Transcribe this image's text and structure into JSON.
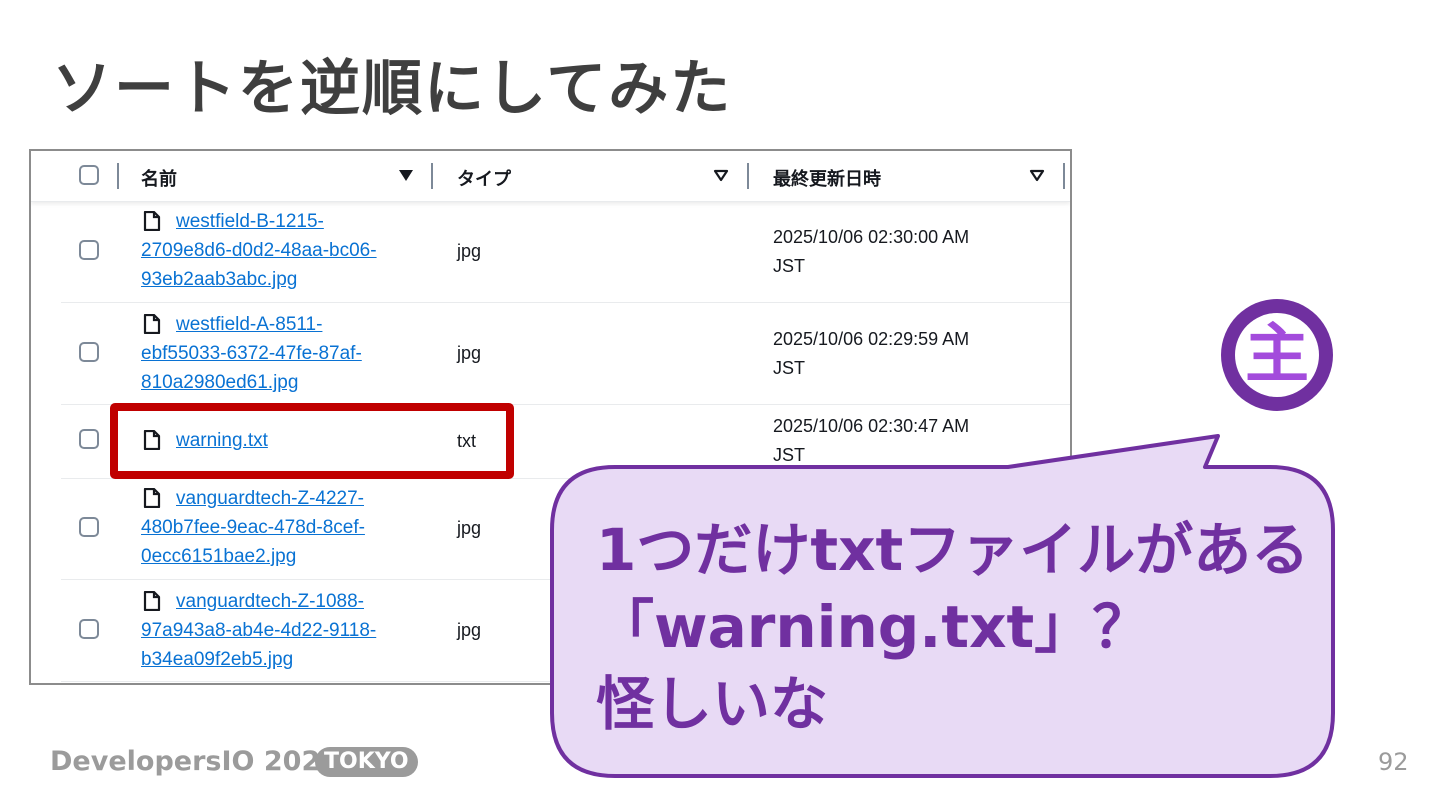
{
  "slide": {
    "title": "ソートを逆順にしてみた",
    "page_number": "92"
  },
  "table": {
    "headers": [
      {
        "label": "名前",
        "sort": "descending-active"
      },
      {
        "label": "タイプ",
        "sort": "inactive"
      },
      {
        "label": "最終更新日時",
        "sort": "inactive"
      }
    ],
    "rows": [
      {
        "name_lines": [
          "westfield-B-1215-",
          "2709e8d6-d0d2-48aa-bc06-",
          "93eb2aab3abc.jpg"
        ],
        "type": "jpg",
        "modified_lines": [
          "2025/10/06 02:30:00 AM",
          "JST"
        ]
      },
      {
        "name_lines": [
          "westfield-A-8511-",
          "ebf55033-6372-47fe-87af-",
          "810a2980ed61.jpg"
        ],
        "type": "jpg",
        "modified_lines": [
          "2025/10/06 02:29:59 AM",
          "JST"
        ]
      },
      {
        "name_lines": [
          "warning.txt"
        ],
        "type": "txt",
        "modified_lines": [
          "2025/10/06 02:30:47 AM",
          "JST"
        ]
      },
      {
        "name_lines": [
          "vanguardtech-Z-4227-",
          "480b7fee-9eac-478d-8cef-",
          "0ecc6151bae2.jpg"
        ],
        "type": "jpg",
        "modified_lines": []
      },
      {
        "name_lines": [
          "vanguardtech-Z-1088-",
          "97a943a8-ab4e-4d22-9118-",
          "b34ea09f2eb5.jpg"
        ],
        "type": "jpg",
        "modified_lines": []
      }
    ]
  },
  "callout": {
    "lines": [
      "1つだけtxtファイルがある",
      "「warning.txt」？",
      "怪しいな"
    ]
  },
  "badge": {
    "glyph": "主"
  },
  "footer": {
    "brand": "DevelopersIO 2025",
    "tag": "TOKYO"
  },
  "colors": {
    "title": "#3f3f3f",
    "link": "#0972d3",
    "highlight": "#c00000",
    "callout_fill": "#e8daf5",
    "callout_text": "#7030a0",
    "badge": "#7030a0",
    "footer": "#9b9b9b"
  }
}
